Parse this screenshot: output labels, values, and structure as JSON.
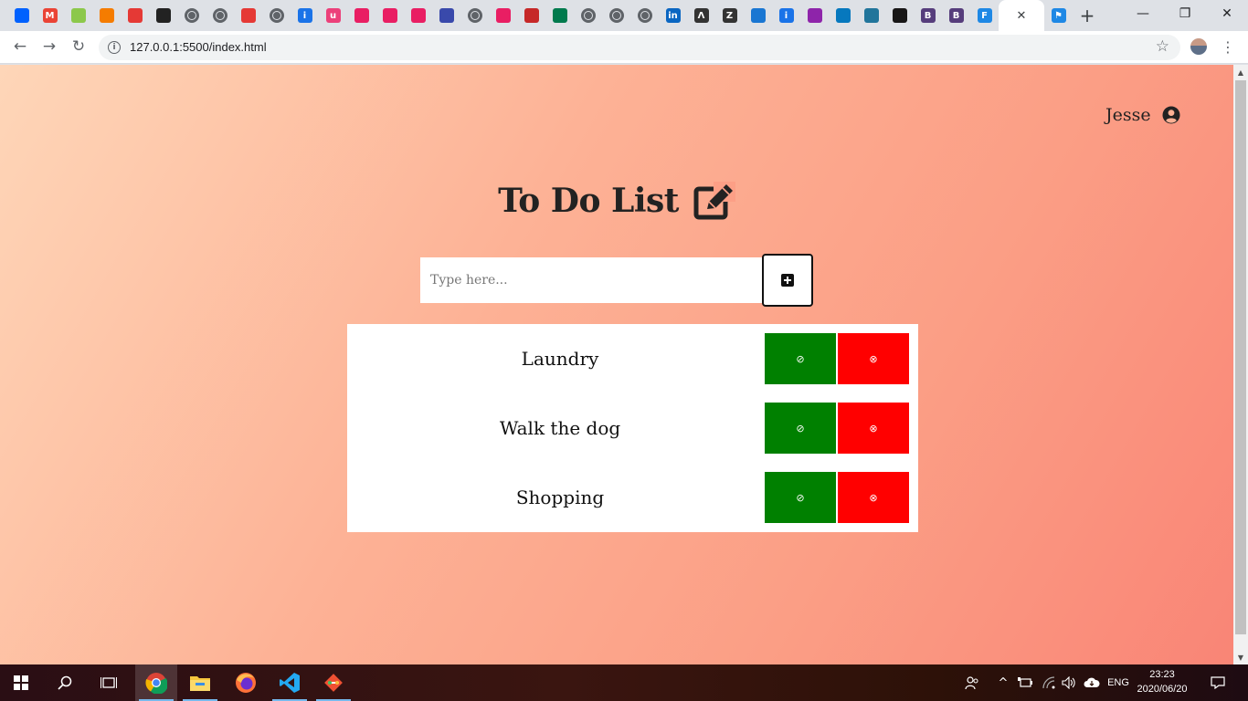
{
  "browser": {
    "tabs": [
      {
        "icon": "dropbox-icon",
        "color": "#0061fe"
      },
      {
        "icon": "gmail-icon",
        "color": "#ea4335"
      },
      {
        "icon": "node-icon",
        "color": "#8cc84b"
      },
      {
        "icon": "person-icon",
        "color": "#f57c00"
      },
      {
        "icon": "bus-icon",
        "color": "#e53935"
      },
      {
        "icon": "arch-icon",
        "color": "#222222"
      },
      {
        "icon": "globe-icon",
        "color": "#5f6368"
      },
      {
        "icon": "globe-icon",
        "color": "#5f6368"
      },
      {
        "icon": "swoosh-icon",
        "color": "#e53935"
      },
      {
        "icon": "globe-icon",
        "color": "#5f6368"
      },
      {
        "icon": "info-icon",
        "color": "#1a73e8"
      },
      {
        "icon": "u-icon",
        "color": "#ec407a"
      },
      {
        "icon": "play-icon",
        "color": "#e91e63"
      },
      {
        "icon": "play-icon",
        "color": "#e91e63"
      },
      {
        "icon": "play-icon",
        "color": "#e91e63"
      },
      {
        "icon": "doc-icon",
        "color": "#3949ab"
      },
      {
        "icon": "globe-icon",
        "color": "#5f6368"
      },
      {
        "icon": "cap-icon",
        "color": "#e91e63"
      },
      {
        "icon": "wave-icon",
        "color": "#c62828"
      },
      {
        "icon": "flag-za-icon",
        "color": "#007a4d"
      },
      {
        "icon": "globe-icon",
        "color": "#5f6368"
      },
      {
        "icon": "globe-icon",
        "color": "#5f6368"
      },
      {
        "icon": "globe-icon",
        "color": "#5f6368"
      },
      {
        "icon": "linkedin-icon",
        "color": "#0a66c2"
      },
      {
        "icon": "lambda-icon",
        "color": "#333333"
      },
      {
        "icon": "z-icon",
        "color": "#333333"
      },
      {
        "icon": "shield-icon",
        "color": "#1976d2"
      },
      {
        "icon": "info-icon",
        "color": "#1a73e8"
      },
      {
        "icon": "bolt-icon",
        "color": "#8e24aa"
      },
      {
        "icon": "drupal-icon",
        "color": "#0678be"
      },
      {
        "icon": "wordpress-icon",
        "color": "#21759b"
      },
      {
        "icon": "github-icon",
        "color": "#181717"
      },
      {
        "icon": "b-icon",
        "color": "#563d7c"
      },
      {
        "icon": "b-icon",
        "color": "#563d7c"
      },
      {
        "icon": "f-icon",
        "color": "#1e88e5"
      }
    ],
    "active_tab": {
      "icon": "flag-icon",
      "color": "#1e88e5",
      "close": "✕"
    },
    "new_tab": "+",
    "window": {
      "minimize": "—",
      "maximize": "❐",
      "close": "✕"
    },
    "nav": {
      "back": "←",
      "forward": "→",
      "reload": "↻"
    },
    "url": "127.0.0.1:5500/index.html",
    "star": "☆",
    "menu": "⋮"
  },
  "app": {
    "user_name": "Jesse",
    "title": "To Do List",
    "input": {
      "placeholder": "Type here...",
      "value": ""
    },
    "tasks": [
      {
        "label": "Laundry",
        "done_glyph": "⊘",
        "delete_glyph": "⊗"
      },
      {
        "label": "Walk the dog",
        "done_glyph": "⊘",
        "delete_glyph": "⊗"
      },
      {
        "label": "Shopping",
        "done_glyph": "⊘",
        "delete_glyph": "⊗"
      }
    ],
    "colors": {
      "done": "#008000",
      "delete": "#ff0000"
    }
  },
  "taskbar": {
    "items": [
      "windows-start-icon",
      "search-icon",
      "task-view-icon",
      "chrome-icon",
      "file-explorer-icon",
      "firefox-icon",
      "vscode-icon",
      "git-icon"
    ],
    "language": "ENG",
    "time": "23:23",
    "date": "2020/06/20"
  }
}
